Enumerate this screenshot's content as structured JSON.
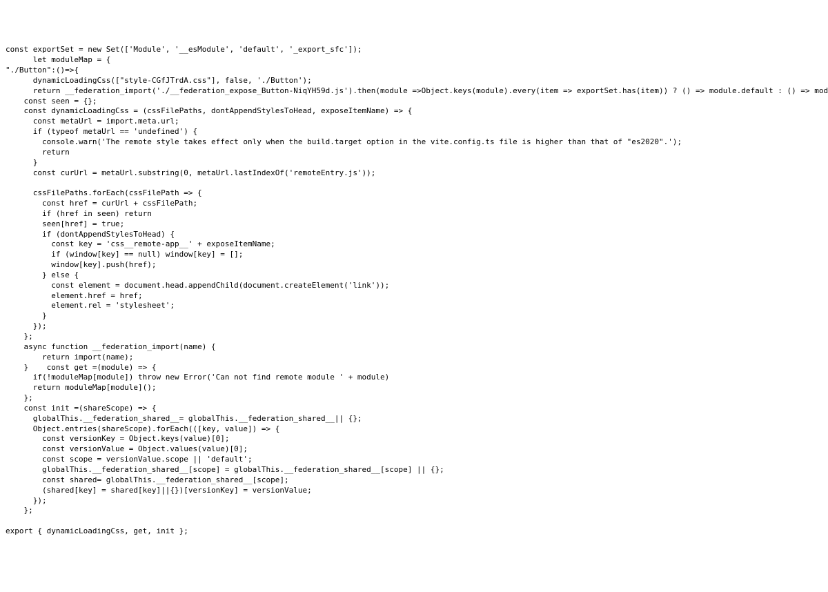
{
  "code_lines": [
    "const exportSet = new Set(['Module', '__esModule', 'default', '_export_sfc']);",
    "      let moduleMap = {",
    "\"./Button\":()=>{",
    "      dynamicLoadingCss([\"style-CGfJTrdA.css\"], false, './Button');",
    "      return __federation_import('./__federation_expose_Button-NiqYH59d.js').then(module =>Object.keys(module).every(item => exportSet.has(item)) ? () => module.default : () => module)},};",
    "    const seen = {};",
    "    const dynamicLoadingCss = (cssFilePaths, dontAppendStylesToHead, exposeItemName) => {",
    "      const metaUrl = import.meta.url;",
    "      if (typeof metaUrl == 'undefined') {",
    "        console.warn('The remote style takes effect only when the build.target option in the vite.config.ts file is higher than that of \"es2020\".');",
    "        return",
    "      }",
    "      const curUrl = metaUrl.substring(0, metaUrl.lastIndexOf('remoteEntry.js'));",
    "",
    "      cssFilePaths.forEach(cssFilePath => {",
    "        const href = curUrl + cssFilePath;",
    "        if (href in seen) return",
    "        seen[href] = true;",
    "        if (dontAppendStylesToHead) {",
    "          const key = 'css__remote-app__' + exposeItemName;",
    "          if (window[key] == null) window[key] = [];",
    "          window[key].push(href);",
    "        } else {",
    "          const element = document.head.appendChild(document.createElement('link'));",
    "          element.href = href;",
    "          element.rel = 'stylesheet';",
    "        }",
    "      });",
    "    };",
    "    async function __federation_import(name) {",
    "        return import(name);",
    "    }    const get =(module) => {",
    "      if(!moduleMap[module]) throw new Error('Can not find remote module ' + module)",
    "      return moduleMap[module]();",
    "    };",
    "    const init =(shareScope) => {",
    "      globalThis.__federation_shared__= globalThis.__federation_shared__|| {};",
    "      Object.entries(shareScope).forEach(([key, value]) => {",
    "        const versionKey = Object.keys(value)[0];",
    "        const versionValue = Object.values(value)[0];",
    "        const scope = versionValue.scope || 'default';",
    "        globalThis.__federation_shared__[scope] = globalThis.__federation_shared__[scope] || {};",
    "        const shared= globalThis.__federation_shared__[scope];",
    "        (shared[key] = shared[key]||{})[versionKey] = versionValue;",
    "      });",
    "    };",
    "",
    "export { dynamicLoadingCss, get, init };"
  ]
}
